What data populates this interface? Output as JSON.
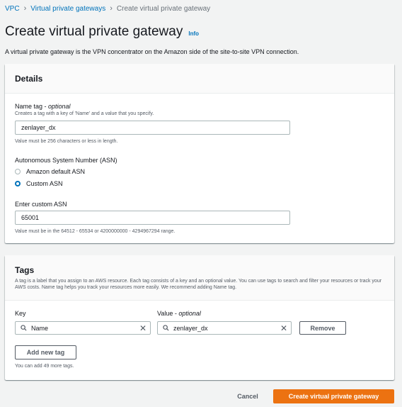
{
  "breadcrumb": {
    "items": [
      "VPC",
      "Virtual private gateways"
    ],
    "current": "Create virtual private gateway",
    "separator": ">"
  },
  "page": {
    "title": "Create virtual private gateway",
    "info_link": "Info",
    "description": "A virtual private gateway is the VPN concentrator on the Amazon side of the site-to-site VPN connection."
  },
  "details": {
    "heading": "Details",
    "name_tag": {
      "label": "Name tag",
      "optional": "optional",
      "description": "Creates a tag with a key of 'Name' and a value that you specify.",
      "value": "zenlayer_dx",
      "constraint": "Value must be 256 characters or less in length."
    },
    "asn": {
      "label": "Autonomous System Number (ASN)",
      "options": [
        "Amazon default ASN",
        "Custom ASN"
      ],
      "selected": "Custom ASN"
    },
    "custom_asn": {
      "label": "Enter custom ASN",
      "value": "65001",
      "constraint": "Value must be in the 64512 - 65534 or 4200000000 - 4294967294 range."
    }
  },
  "tags": {
    "heading": "Tags",
    "description": "A tag is a label that you assign to an AWS resource. Each tag consists of a key and an optional value. You can use tags to search and filter your resources or track your AWS costs. Name tag helps you track your resources more easily. We recommend adding Name tag.",
    "key_label": "Key",
    "value_label": "Value",
    "value_optional": "optional",
    "rows": [
      {
        "key": "Name",
        "value": "zenlayer_dx"
      }
    ],
    "remove_label": "Remove",
    "add_label": "Add new tag",
    "limit_note": "You can add 49 more tags."
  },
  "footer": {
    "cancel_label": "Cancel",
    "submit_label": "Create virtual private gateway"
  },
  "colors": {
    "link": "#0073bb",
    "primary": "#ec7211",
    "background": "#f2f3f3"
  }
}
